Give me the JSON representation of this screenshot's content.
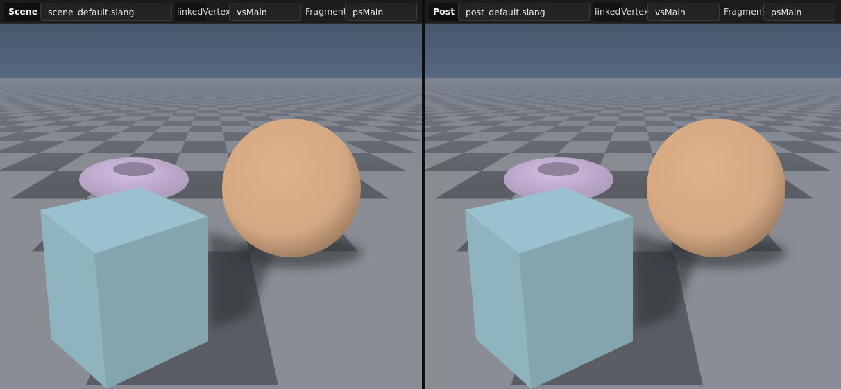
{
  "panels": [
    {
      "label": "Scene",
      "file": "scene_default.slang",
      "link_state": "linked",
      "vertex_label": "Vertex",
      "vertex_entry": "vsMain",
      "fragment_label": "Fragment",
      "fragment_entry": "psMain"
    },
    {
      "label": "Post",
      "file": "post_default.slang",
      "link_state": "linked",
      "vertex_label": "Vertex",
      "vertex_entry": "vsMain",
      "fragment_label": "Fragment",
      "fragment_entry": "psMain"
    }
  ],
  "colors": {
    "sky": "#4f5d73",
    "floor_light": "#8a8d93",
    "floor_dark": "#5a5d63",
    "torus": "#c7b3d6",
    "sphere": "#d4a882",
    "cube": "#8fb3bf"
  }
}
